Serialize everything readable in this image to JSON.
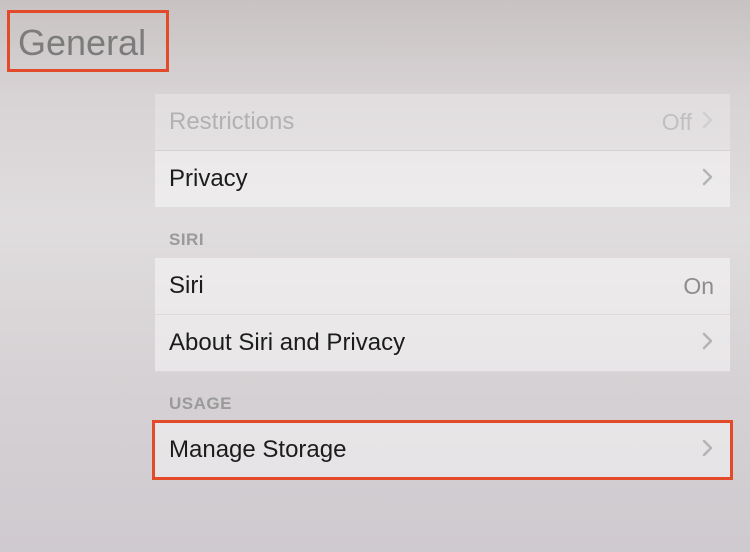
{
  "header": {
    "title": "General"
  },
  "sections": {
    "prior": {
      "restrictions": {
        "label": "Restrictions",
        "value": "Off"
      },
      "privacy": {
        "label": "Privacy"
      }
    },
    "siri": {
      "header": "SIRI",
      "siri_row": {
        "label": "Siri",
        "value": "On"
      },
      "about": {
        "label": "About Siri and Privacy"
      }
    },
    "usage": {
      "header": "USAGE",
      "manage": {
        "label": "Manage Storage"
      }
    }
  }
}
